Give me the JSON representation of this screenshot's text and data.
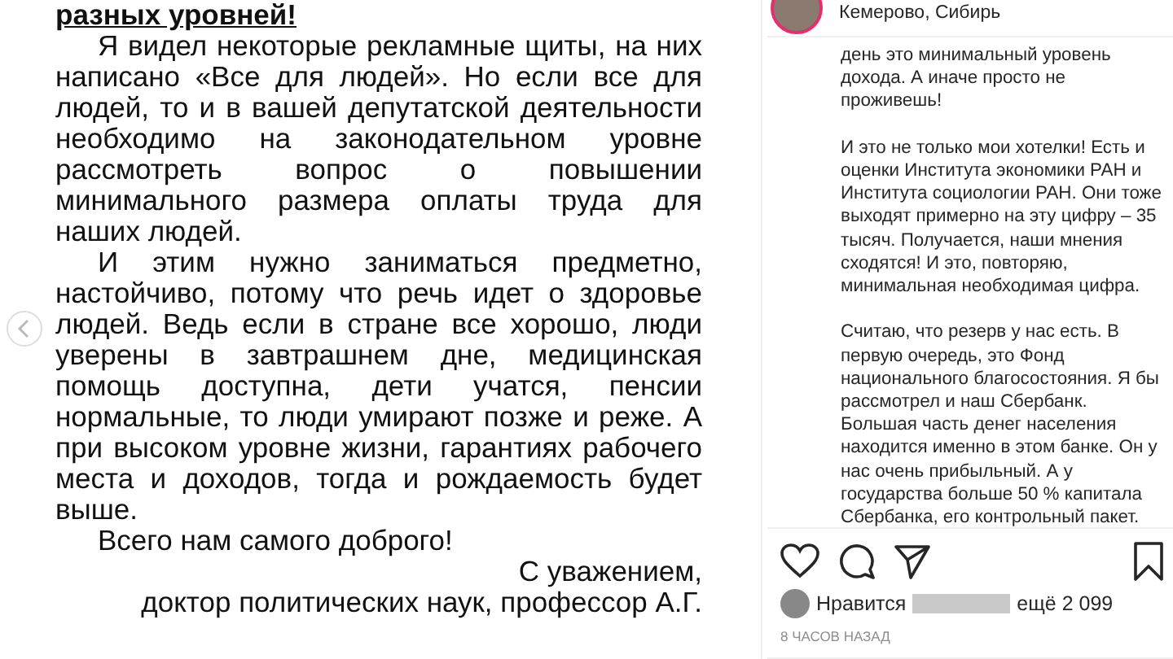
{
  "post_image": {
    "heading": "разных уровней!",
    "paragraphs": [
      "Я видел некоторые рекламные щиты, на них написано «Все для людей». Но если все для людей, то и в вашей депутатской деятельности необходимо на законодательном уровне рассмотреть вопрос о повышении минимального размера оплаты труда для наших людей.",
      "И этим нужно заниматься предметно, настойчиво, потому что речь идет о здоровье людей. Ведь если в стране все хорошо, люди уверены в завтрашнем дне, медицинская помощь доступна, дети учатся, пенсии нормальные, то люди умирают позже и реже. А при высоком уровне жизни, гарантиях рабочего места и доходов, тогда и рождаемость будет выше.",
      "Всего нам самого доброго!"
    ],
    "closing": "С уважением,",
    "signature": "доктор политических наук, профессор А.Г."
  },
  "author": {
    "location": "Кемерово, Сибирь"
  },
  "caption": {
    "paragraphs": [
      "день это минимальный уровень дохода. А иначе просто не проживешь!",
      "И это не только мои хотелки! Есть и оценки Института экономики РАН и Института социологии РАН. Они тоже выходят примерно на эту цифру – 35 тысяч. Получается, наши мнения сходятся! И это, повторяю, минимальная необходимая цифра.",
      "Считаю, что резерв у нас есть. В первую очередь, это Фонд национального благосостояния. Я бы рассмотрел и наш Сбербанк. Большая часть денег населения находится именно в этом банке. Он у нас очень прибыльный. А у государства больше 50 % капитала Сбербанка, его контрольный пакет."
    ]
  },
  "likes": {
    "label": "Нравится",
    "more": "ещё 2 099"
  },
  "time": "8 ЧАСОВ НАЗАД"
}
